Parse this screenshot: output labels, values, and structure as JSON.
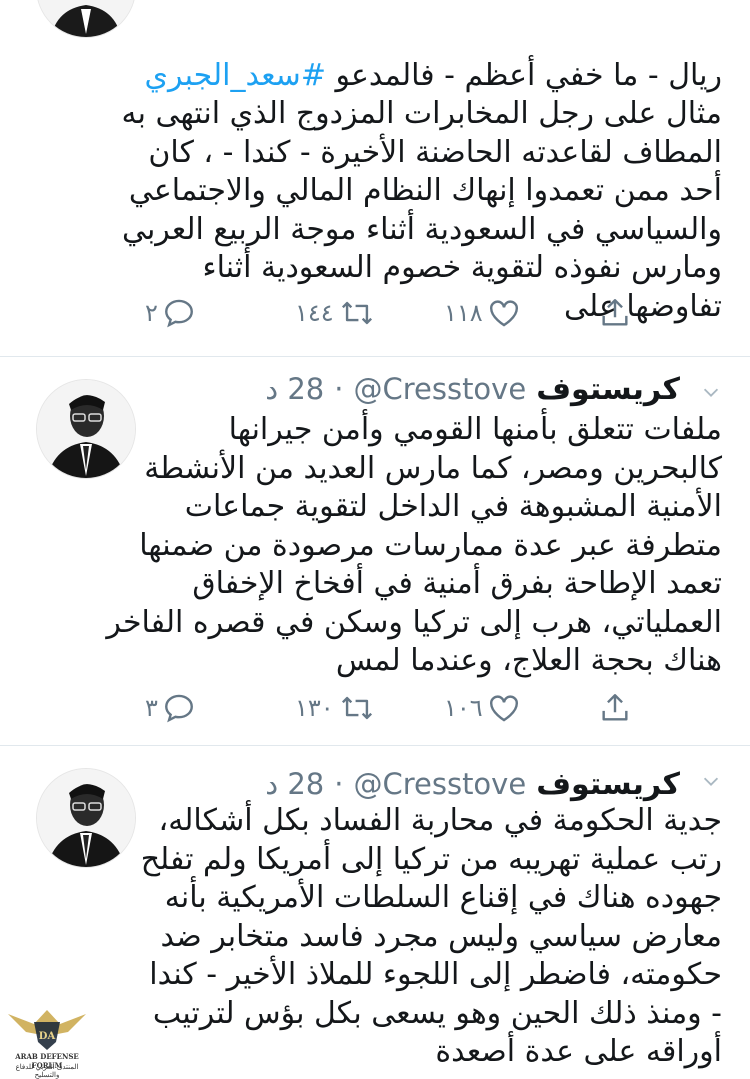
{
  "tweets": [
    {
      "text_before": "ريال - ما خفي أعظم - فالمدعو ",
      "hashtag": "#سعد_الجبري",
      "text_after": "\nمثال على رجل المخابرات المزدوج الذي انتهى به\nالمطاف لقاعدته الحاضنة الأخيرة - كندا - ، كان\nأحد ممن تعمدوا إنهاك النظام المالي والاجتماعي\nوالسياسي في السعودية أثناء موجة الربيع العربي\nومارس نفوذه لتقوية خصوم السعودية أثناء\nتفاوضها على",
      "replies": "٢",
      "retweets": "١٤٤",
      "likes": "١١٨"
    },
    {
      "name": "كريستوف",
      "handle": "@Cresstove",
      "separator": "·",
      "time": "28 د",
      "text": "ملفات تتعلق بأمنها القومي وأمن جيرانها\nكالبحرين ومصر، كما مارس العديد من الأنشطة\nالأمنية المشبوهة في الداخل لتقوية جماعات\nمتطرفة عبر عدة ممارسات مرصودة من ضمنها\nتعمد الإطاحة بفرق أمنية في أفخاخ الإخفاق\nالعملياتي، هرب إلى تركيا وسكن في قصره الفاخر\nهناك بحجة العلاج، وعندما لمس",
      "replies": "٣",
      "retweets": "١٣٠",
      "likes": "١٠٦"
    },
    {
      "name": "كريستوف",
      "handle": "@Cresstove",
      "separator": "·",
      "time": "28 د",
      "text": "جدية الحكومة في محاربة الفساد بكل أشكاله،\nرتب عملية تهريبه من تركيا إلى أمريكا ولم تفلح\nجهوده هناك في إقناع السلطات الأمريكية بأنه\nمعارض سياسي وليس مجرد فاسد متخابر ضد\nحكومته، فاضطر إلى اللجوء للملاذ الأخير - كندا\n- ومنذ ذلك الحين وهو يسعى بكل بؤس لترتيب\nأوراقه على عدة أصعدة"
    }
  ],
  "watermark": {
    "title": "ARAB DEFENSE FORUM",
    "subtitle": "المنتدى العربي للدفاع والتسليح",
    "logo_initials": "DA"
  },
  "colors": {
    "text": "#14171a",
    "muted": "#657786",
    "link": "#1da1f2",
    "divider": "#e1e8ed"
  },
  "icons": [
    "reply-icon",
    "retweet-icon",
    "like-icon",
    "share-icon",
    "chevron-down-icon"
  ]
}
